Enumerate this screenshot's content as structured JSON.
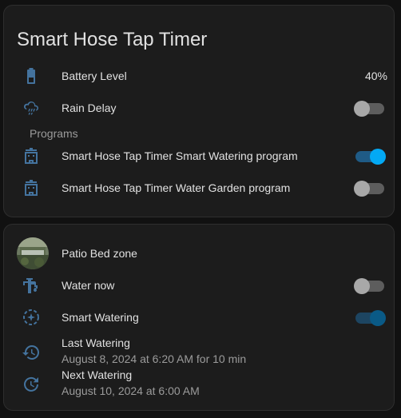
{
  "card1": {
    "title": "Smart Hose Tap Timer",
    "battery": {
      "label": "Battery Level",
      "value": "40%",
      "icon": "battery-icon",
      "level": 0.4
    },
    "rain_delay": {
      "label": "Rain Delay",
      "icon": "weather-rainy-icon",
      "state": "off"
    },
    "programs_header": "Programs",
    "programs": [
      {
        "label": "Smart Hose Tap Timer Smart Watering program",
        "icon": "program-icon",
        "state": "on"
      },
      {
        "label": "Smart Hose Tap Timer Water Garden program",
        "icon": "program-icon",
        "state": "off"
      }
    ]
  },
  "card2": {
    "zone_name": "Patio Bed zone",
    "water_now": {
      "label": "Water now",
      "icon": "water-pump-icon",
      "state": "off"
    },
    "smart_watering": {
      "label": "Smart Watering",
      "icon": "smart-watering-icon",
      "state": "on"
    },
    "last_watering": {
      "label": "Last Watering",
      "value": "August 8, 2024 at 6:20 AM for 10 min",
      "icon": "history-icon"
    },
    "next_watering": {
      "label": "Next Watering",
      "value": "August 10, 2024 at 6:00 AM",
      "icon": "clock-next-icon"
    }
  },
  "colors": {
    "accent": "#03a9f4",
    "icon": "#44739e",
    "background": "#111111",
    "card": "#1c1c1c"
  }
}
